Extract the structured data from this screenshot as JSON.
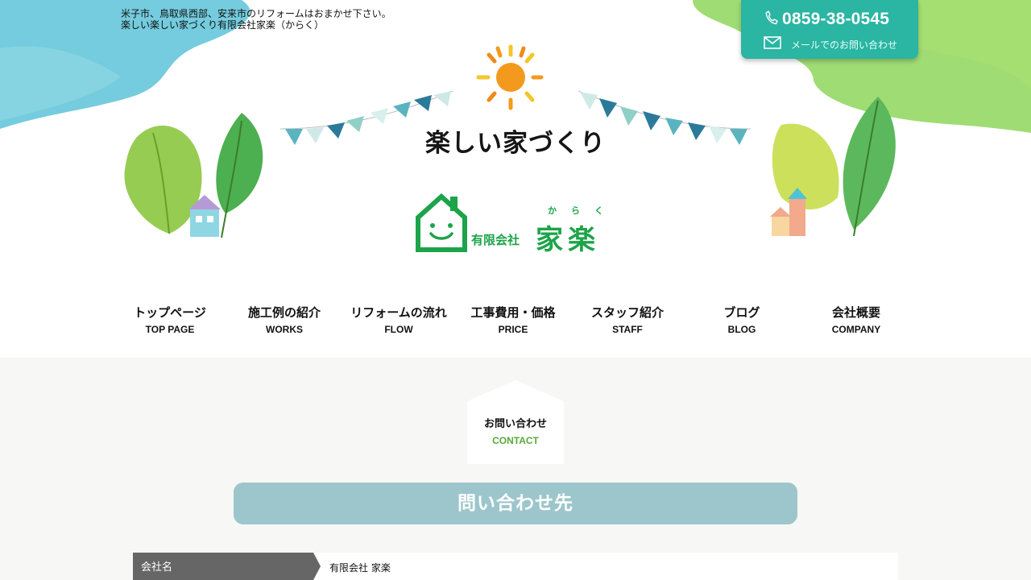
{
  "tagline": {
    "line1": "米子市、鳥取県西部、安来市のリフォームはおまかせ下さい。",
    "line2": "楽しい楽しい家づくり有限会社家楽（からく）"
  },
  "contact": {
    "phone": "0859-38-0545",
    "mail_label": "メールでのお問い合わせ"
  },
  "brand": {
    "title": "楽しい家づくり",
    "logo_small": "有限会社",
    "logo_big": "家楽",
    "logo_ruby": "からく"
  },
  "nav": [
    {
      "jp": "トップページ",
      "en": "TOP PAGE"
    },
    {
      "jp": "施工例の紹介",
      "en": "WORKS"
    },
    {
      "jp": "リフォームの流れ",
      "en": "FLOW"
    },
    {
      "jp": "工事費用・価格",
      "en": "PRICE"
    },
    {
      "jp": "スタッフ紹介",
      "en": "STAFF"
    },
    {
      "jp": "ブログ",
      "en": "BLOG"
    },
    {
      "jp": "会社概要",
      "en": "COMPANY"
    }
  ],
  "page": {
    "heading_jp": "お問い合わせ",
    "heading_en": "CONTACT",
    "section_title": "問い合わせ先"
  },
  "table": [
    {
      "label": "会社名",
      "value": "有限会社 家楽"
    }
  ],
  "colors": {
    "accent_teal": "#2bb5a3",
    "brand_green": "#1ca44a",
    "section_bar": "#9cc6cb",
    "header_cell": "#666666"
  },
  "icons": [
    "phone-icon",
    "mail-icon",
    "sun-icon",
    "house-logo-icon"
  ]
}
